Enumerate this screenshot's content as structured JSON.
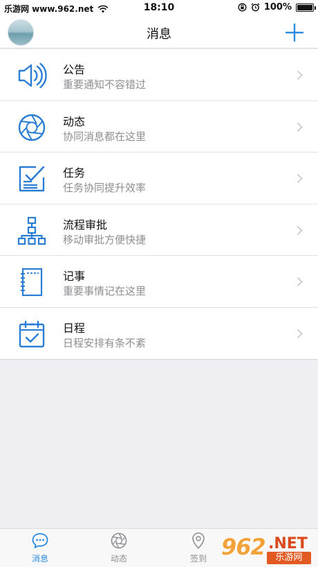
{
  "status_bar": {
    "carrier": "乐游网 www.962.net",
    "time": "18:10",
    "battery": "100%",
    "battery_level": 1.0
  },
  "nav": {
    "title": "消息"
  },
  "items": [
    {
      "title": "公告",
      "subtitle": "重要通知不容错过",
      "icon": "speaker-icon"
    },
    {
      "title": "动态",
      "subtitle": "协同消息都在这里",
      "icon": "aperture-icon"
    },
    {
      "title": "任务",
      "subtitle": "任务协同提升效率",
      "icon": "task-check-icon"
    },
    {
      "title": "流程审批",
      "subtitle": "移动审批方便快捷",
      "icon": "org-chart-icon"
    },
    {
      "title": "记事",
      "subtitle": "重要事情记在这里",
      "icon": "notebook-icon"
    },
    {
      "title": "日程",
      "subtitle": "日程安排有条不紊",
      "icon": "calendar-check-icon"
    }
  ],
  "tabs": [
    {
      "label": "消息",
      "icon": "chat-bubble-icon",
      "active": true
    },
    {
      "label": "动态",
      "icon": "aperture-icon",
      "active": false
    },
    {
      "label": "签到",
      "icon": "location-pin-icon",
      "active": false
    }
  ],
  "watermark": {
    "number": "962",
    "suffix": ".NET",
    "name": "乐游网"
  },
  "colors": {
    "accent": "#2b8be0",
    "icon_blue": "#2a7dd4",
    "subtitle": "#8e8e93",
    "background": "#efeff4"
  }
}
